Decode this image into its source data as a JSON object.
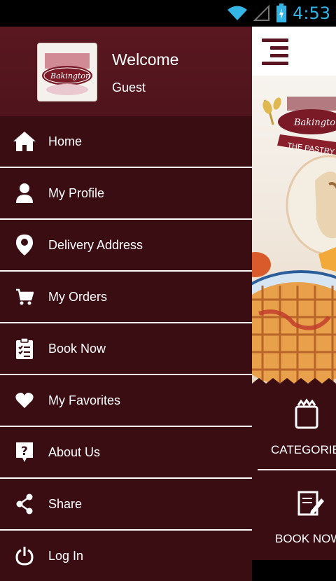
{
  "status_bar": {
    "time": "4:53"
  },
  "drawer": {
    "welcome": "Welcome",
    "user": "Guest",
    "items": [
      {
        "label": "Home",
        "icon": "home-icon"
      },
      {
        "label": "My Profile",
        "icon": "user-icon"
      },
      {
        "label": "Delivery Address",
        "icon": "map-pin-icon"
      },
      {
        "label": "My Orders",
        "icon": "cart-icon"
      },
      {
        "label": "Book Now",
        "icon": "clipboard-icon"
      },
      {
        "label": "My Favorites",
        "icon": "heart-icon"
      },
      {
        "label": "About Us",
        "icon": "help-icon"
      },
      {
        "label": "Share",
        "icon": "share-icon"
      },
      {
        "label": "Log In",
        "icon": "power-icon"
      }
    ]
  },
  "main": {
    "brand_text": "Bakington",
    "tagline": "THE PASTRY S",
    "tiles": [
      {
        "label": "CATEGORIE",
        "icon": "shopping-bag-icon"
      },
      {
        "label": "BOOK NOW",
        "icon": "edit-note-icon"
      }
    ]
  },
  "colors": {
    "brand_maroon": "#3a0d13",
    "header_maroon": "#5a1720",
    "status_blue": "#33b5e5"
  }
}
